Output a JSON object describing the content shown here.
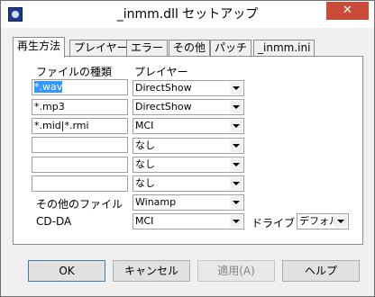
{
  "window": {
    "title": "_inmm.dll セットアップ",
    "close_glyph": "✕"
  },
  "tabs": [
    {
      "label": "再生方法",
      "active": true
    },
    {
      "label": "プレイヤー",
      "active": false
    },
    {
      "label": "エラー",
      "active": false
    },
    {
      "label": "その他",
      "active": false
    },
    {
      "label": "パッチ",
      "active": false
    },
    {
      "label": "_inmm.ini",
      "active": false
    }
  ],
  "headers": {
    "file_type": "ファイルの種類",
    "player": "プレイヤー"
  },
  "rows": [
    {
      "file": "*.wav",
      "file_selected": true,
      "player": "DirectShow"
    },
    {
      "file": "*.mp3",
      "file_selected": false,
      "player": "DirectShow"
    },
    {
      "file": "*.mid|*.rmi",
      "file_selected": false,
      "player": "MCI"
    },
    {
      "file": "",
      "file_selected": false,
      "player": "なし"
    },
    {
      "file": "",
      "file_selected": false,
      "player": "なし"
    },
    {
      "file": "",
      "file_selected": false,
      "player": "なし"
    }
  ],
  "other_files": {
    "label": "その他のファイル",
    "player": "Winamp"
  },
  "cdda": {
    "label": "CD-DA",
    "player": "MCI",
    "drive_label": "ドライブ",
    "drive_value": "デフォルト"
  },
  "buttons": {
    "ok": "OK",
    "cancel": "キャンセル",
    "apply": "適用(A)",
    "help": "ヘルプ"
  },
  "colors": {
    "close_button": "#c94c3b",
    "selection": "#3399ff"
  }
}
